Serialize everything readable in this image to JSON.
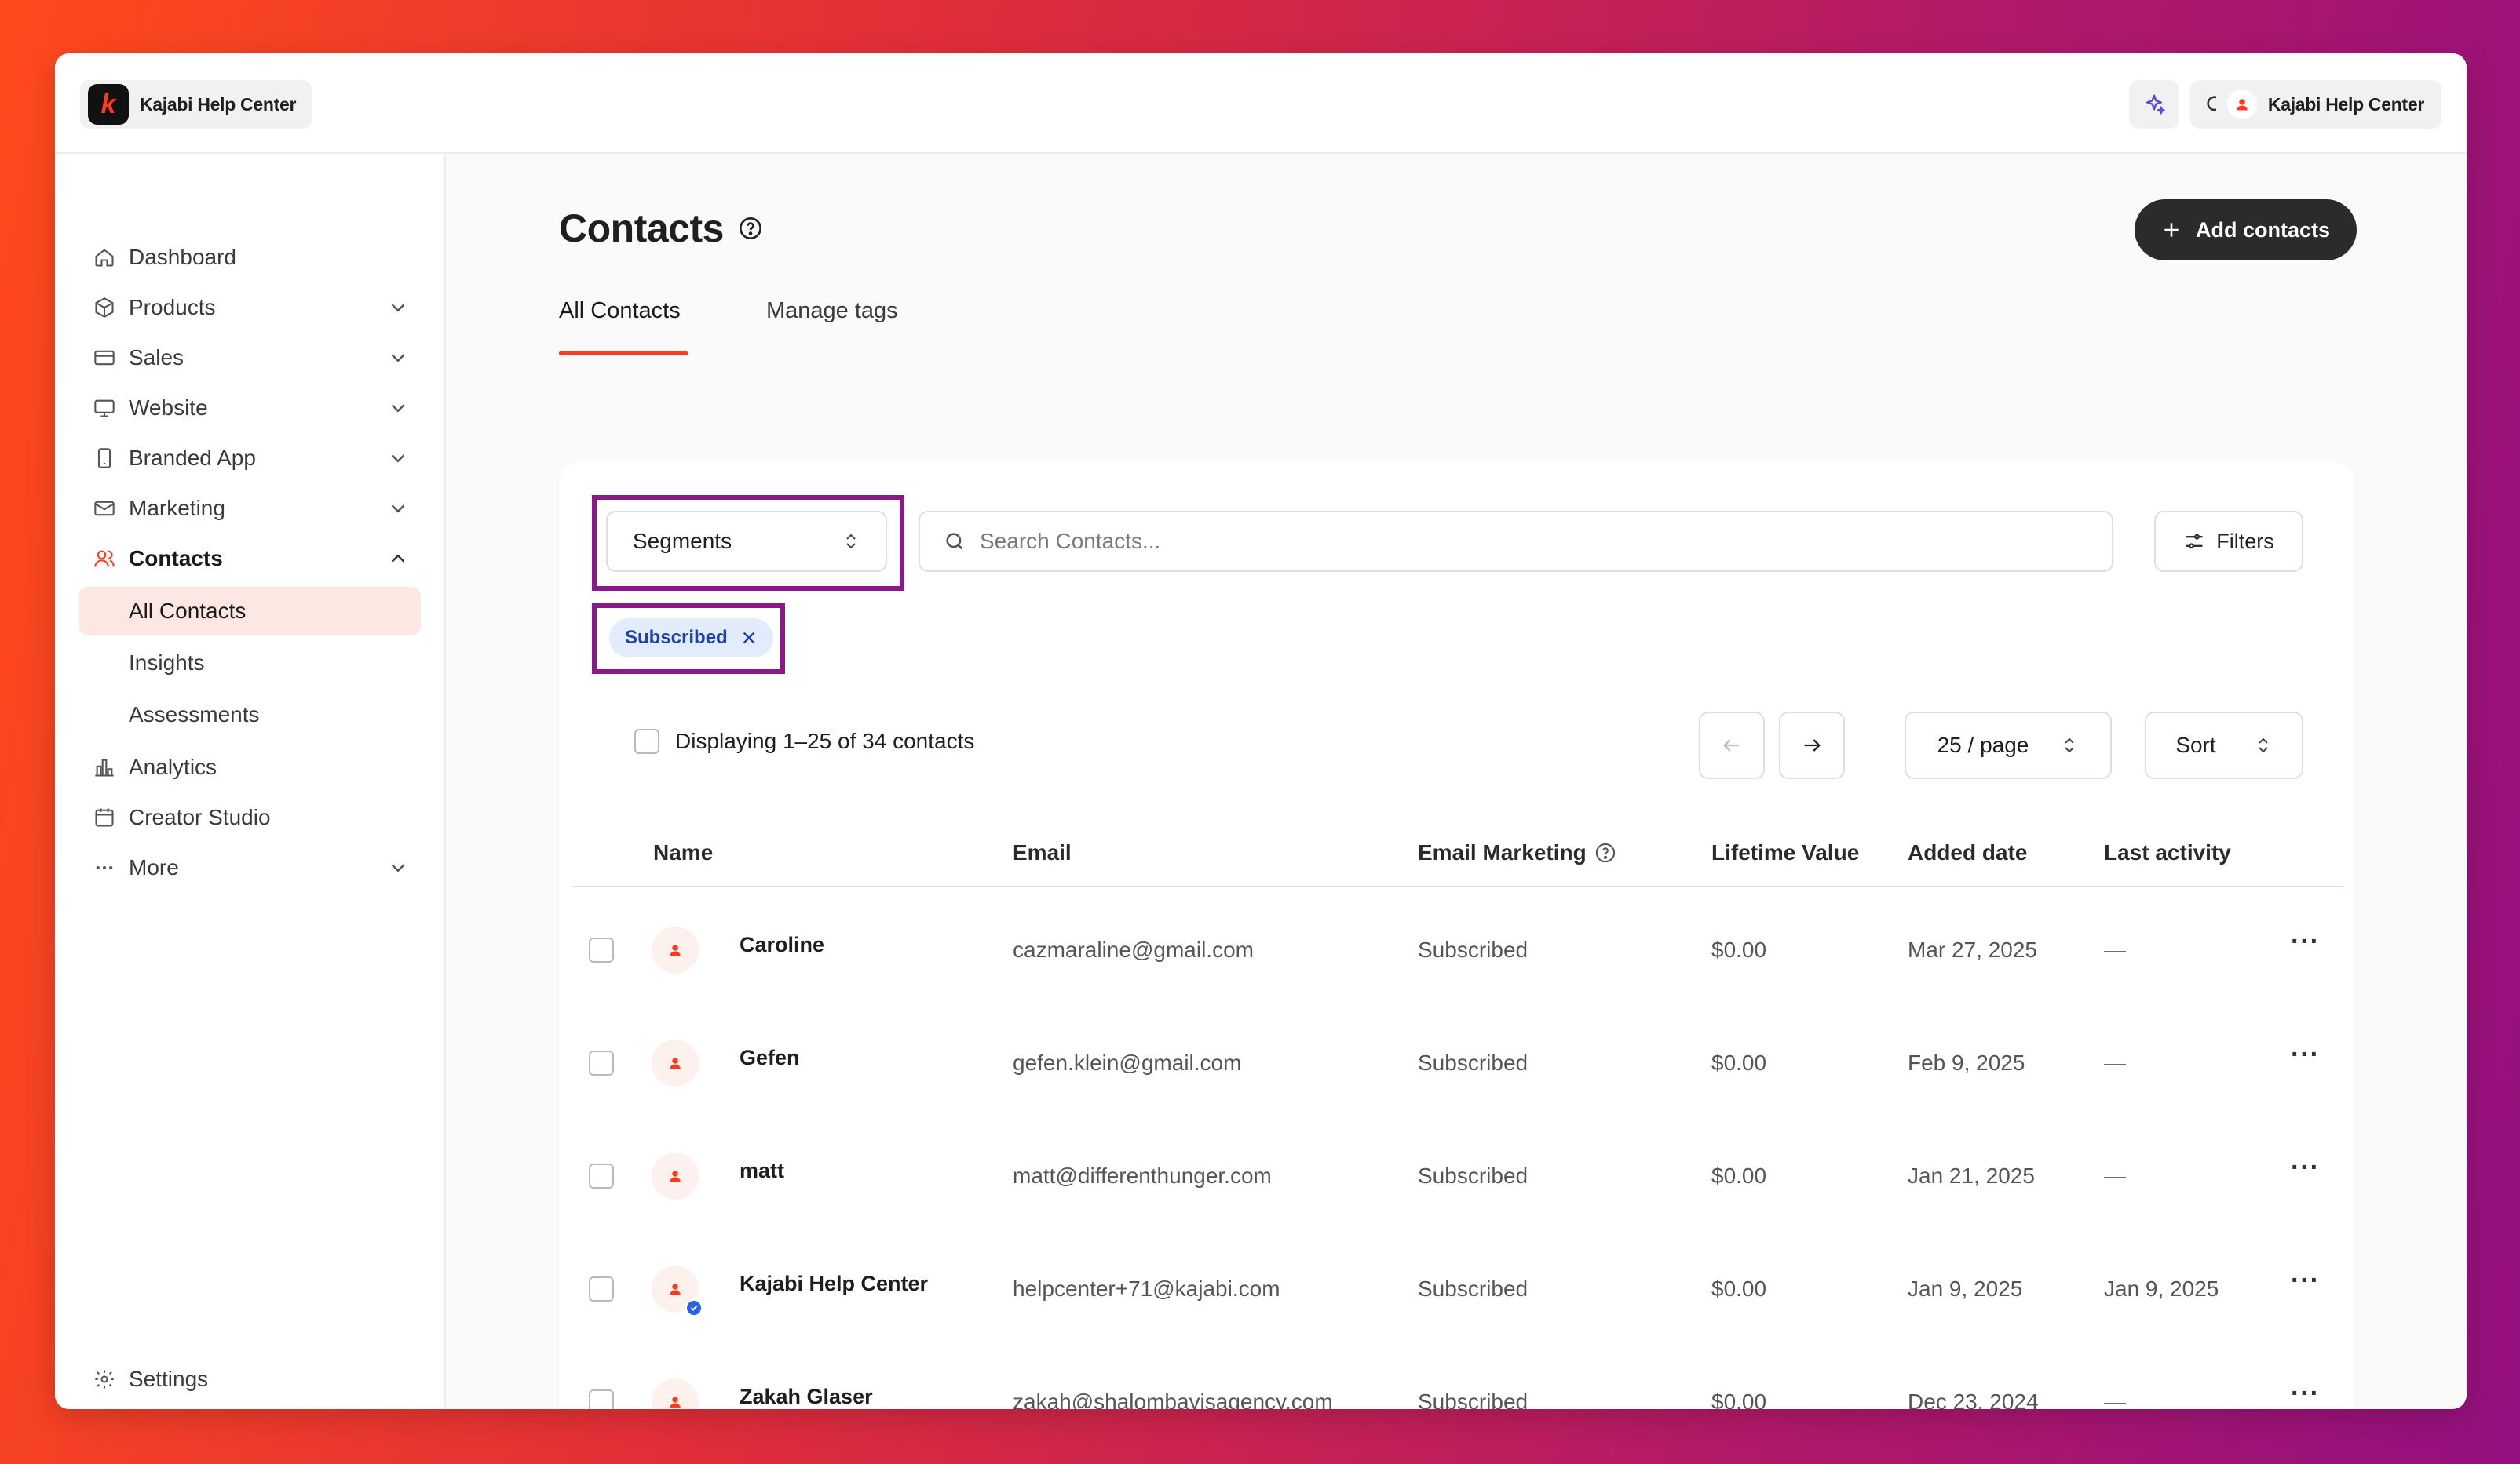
{
  "app": {
    "name": "Kajabi Help Center",
    "logo_letter": "k",
    "user_name": "Kajabi Help Center"
  },
  "sidebar": {
    "items": [
      {
        "label": "Dashboard",
        "icon": "home-icon"
      },
      {
        "label": "Products",
        "icon": "box-icon"
      },
      {
        "label": "Sales",
        "icon": "credit-card-icon"
      },
      {
        "label": "Website",
        "icon": "monitor-icon"
      },
      {
        "label": "Branded App",
        "icon": "phone-icon"
      },
      {
        "label": "Marketing",
        "icon": "mail-icon"
      },
      {
        "label": "Contacts",
        "icon": "users-icon"
      },
      {
        "label": "Analytics",
        "icon": "bar-chart-icon"
      },
      {
        "label": "Creator Studio",
        "icon": "calendar-icon"
      },
      {
        "label": "More",
        "icon": "more-icon"
      }
    ],
    "contacts_sub": [
      "All Contacts",
      "Insights",
      "Assessments"
    ],
    "settings_label": "Settings"
  },
  "page": {
    "title": "Contacts",
    "add_button": "Add contacts",
    "tabs": [
      "All Contacts",
      "Manage tags"
    ]
  },
  "toolbar": {
    "segments_label": "Segments",
    "search_placeholder": "Search Contacts...",
    "filters_label": "Filters",
    "active_filter": "Subscribed",
    "display_text": "Displaying 1–25 of 34 contacts",
    "per_page": "25 / page",
    "sort_label": "Sort"
  },
  "table": {
    "headers": [
      "Name",
      "Email",
      "Email Marketing",
      "Lifetime Value",
      "Added date",
      "Last activity"
    ],
    "rows": [
      {
        "name": "Caroline",
        "email": "cazmaraline@gmail.com",
        "marketing": "Subscribed",
        "ltv": "$0.00",
        "added": "Mar 27, 2025",
        "last": "—",
        "verified": false
      },
      {
        "name": "Gefen",
        "email": "gefen.klein@gmail.com",
        "marketing": "Subscribed",
        "ltv": "$0.00",
        "added": "Feb 9, 2025",
        "last": "—",
        "verified": false
      },
      {
        "name": "matt",
        "email": "matt@differenthunger.com",
        "marketing": "Subscribed",
        "ltv": "$0.00",
        "added": "Jan 21, 2025",
        "last": "—",
        "verified": false
      },
      {
        "name": "Kajabi Help Center",
        "email": "helpcenter+71@kajabi.com",
        "marketing": "Subscribed",
        "ltv": "$0.00",
        "added": "Jan 9, 2025",
        "last": "Jan 9, 2025",
        "verified": true
      },
      {
        "name": "Zakah Glaser",
        "email": "zakah@shalombayisagency.com",
        "marketing": "Subscribed",
        "ltv": "$0.00",
        "added": "Dec 23, 2024",
        "last": "—",
        "verified": true
      }
    ],
    "row_menu": "···"
  },
  "colors": {
    "accent": "#ff3b1f",
    "highlight": "#8a1a8a",
    "chip_bg": "#e3ecfd",
    "chip_text": "#1e40af"
  }
}
